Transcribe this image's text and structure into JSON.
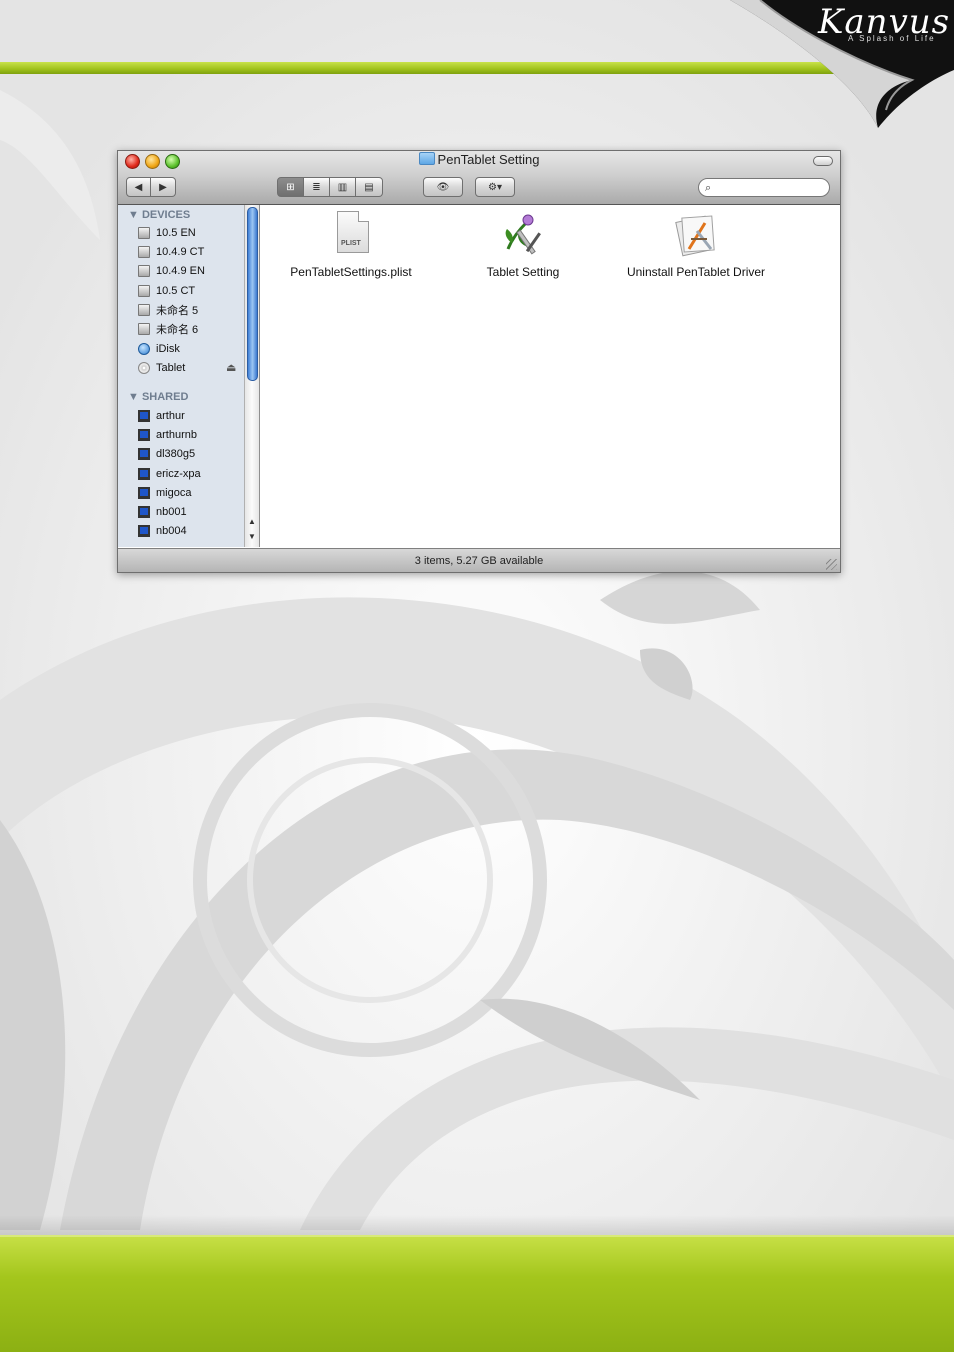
{
  "brand": {
    "name": "Kanvus",
    "tagline": "A Splash of Life"
  },
  "window": {
    "title": "PenTablet Setting",
    "toolbar": {
      "back_icon": "◀",
      "forward_icon": "▶",
      "view_icons": [
        "⊞",
        "≣",
        "▥",
        "▤"
      ],
      "quicklook_icon": "👁",
      "action_icon": "⚙▾",
      "search_placeholder": ""
    },
    "sidebar": {
      "devices_header": "▼ DEVICES",
      "devices": [
        {
          "label": "10.5 EN",
          "icon": "disk-icon"
        },
        {
          "label": "10.4.9 CT",
          "icon": "disk-icon"
        },
        {
          "label": "10.4.9 EN",
          "icon": "disk-icon"
        },
        {
          "label": "10.5 CT",
          "icon": "disk-icon"
        },
        {
          "label": "未命名 5",
          "icon": "disk-icon"
        },
        {
          "label": "未命名 6",
          "icon": "disk-icon"
        },
        {
          "label": "iDisk",
          "icon": "idisk-icon"
        },
        {
          "label": "Tablet",
          "icon": "cd-icon",
          "eject": "⏏"
        }
      ],
      "shared_header": "▼ SHARED",
      "shared": [
        {
          "label": "arthur"
        },
        {
          "label": "arthurnb"
        },
        {
          "label": "dl380g5"
        },
        {
          "label": "ericz-xpa"
        },
        {
          "label": "migoca"
        },
        {
          "label": "nb001"
        },
        {
          "label": "nb004"
        }
      ]
    },
    "files": [
      {
        "label": "PenTabletSettings.plist",
        "icon": "plist-document-icon",
        "tag": "PLIST"
      },
      {
        "label": "Tablet Setting",
        "icon": "tablet-setting-app-icon"
      },
      {
        "label": "Uninstall PenTablet Driver",
        "icon": "uninstaller-app-icon"
      }
    ],
    "status": "3 items, 5.27 GB available"
  },
  "colors": {
    "accent_green": "#9fc11a",
    "sidebar_bg": "#dde4ed"
  }
}
